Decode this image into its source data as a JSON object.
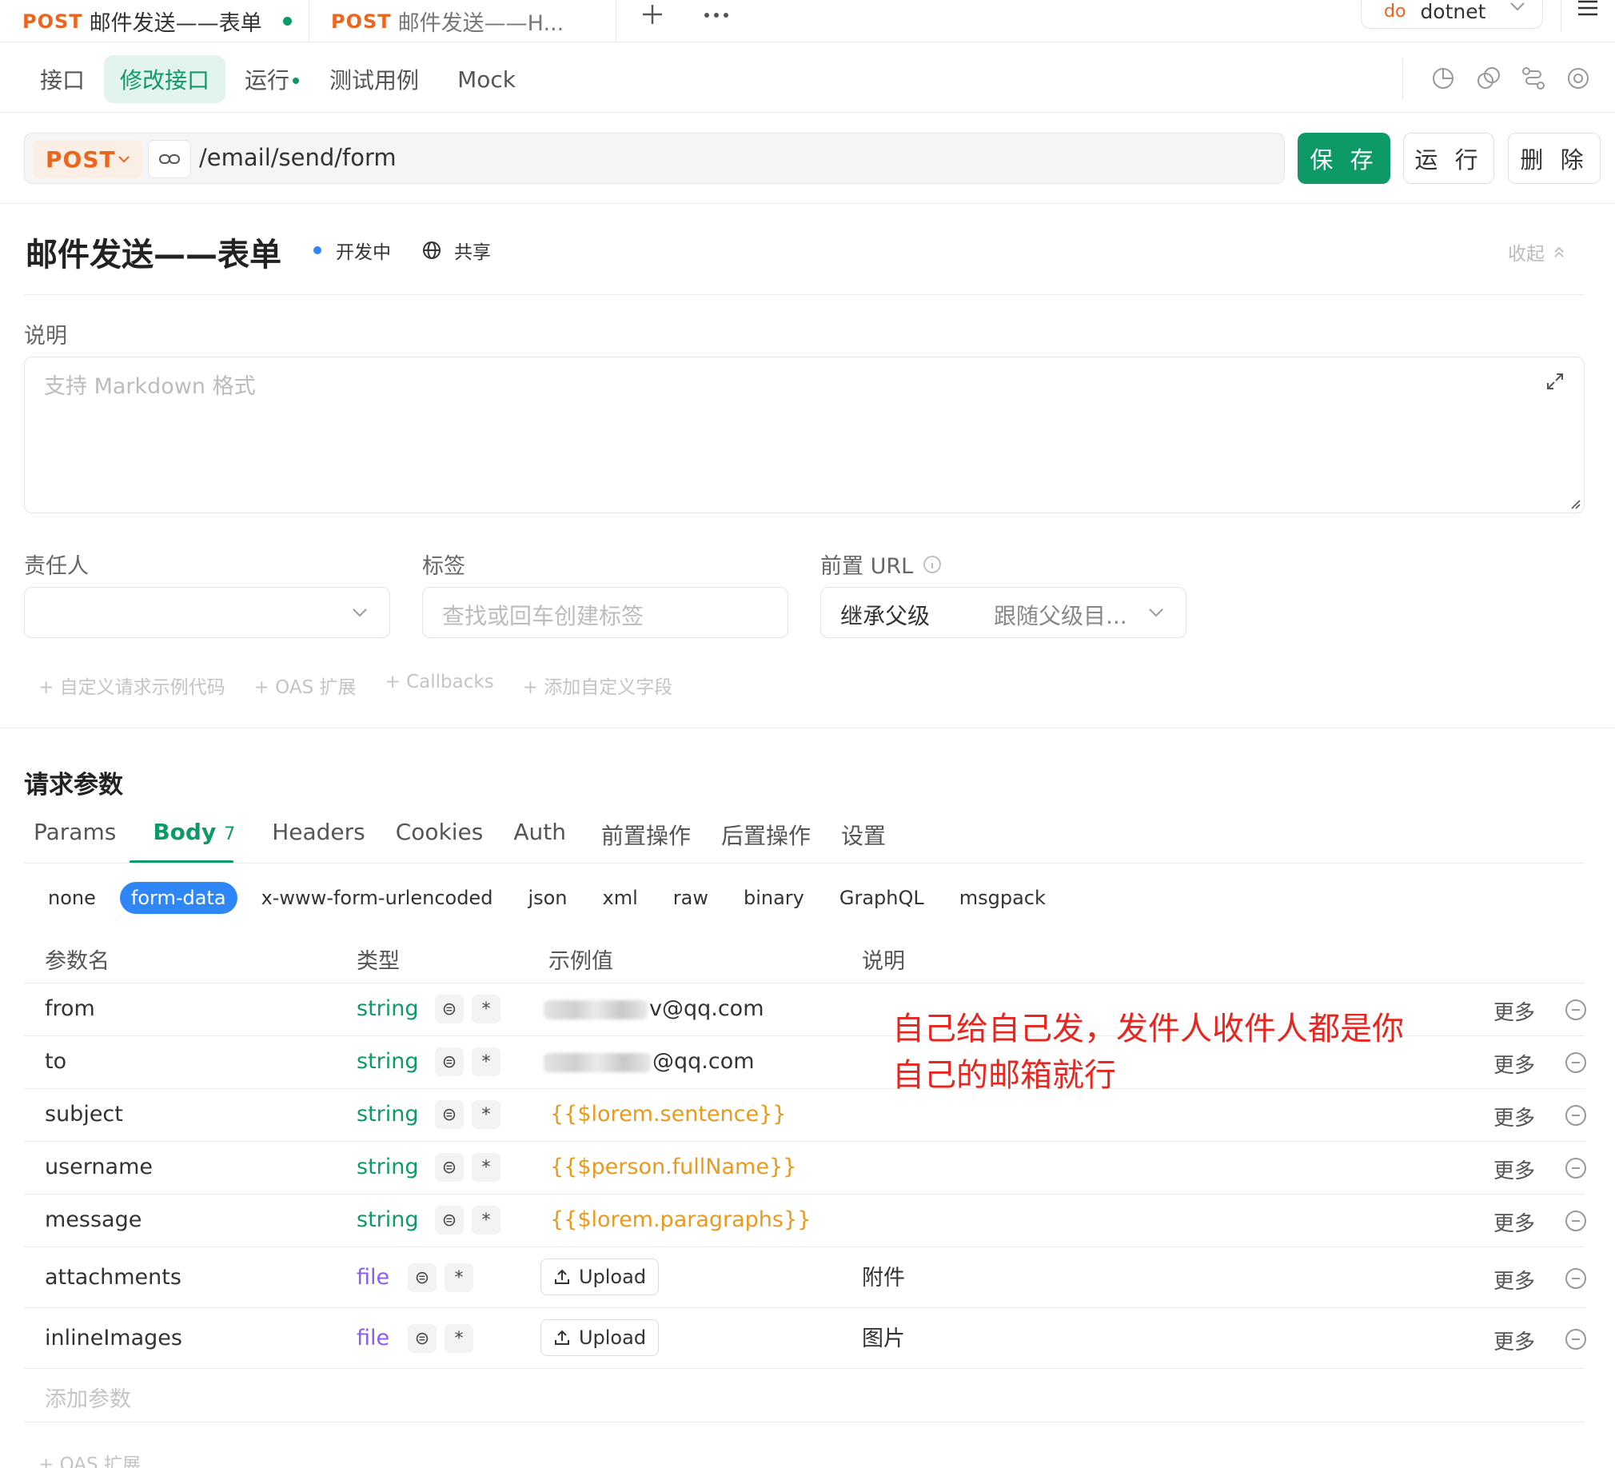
{
  "tabs": [
    {
      "method": "POST",
      "title": "邮件发送——表单",
      "modified": true
    },
    {
      "method": "POST",
      "title": "邮件发送——H..."
    }
  ],
  "env": {
    "badge": "do",
    "name": "dotnet"
  },
  "subtabs": [
    "接口",
    "修改接口",
    "运行",
    "测试用例",
    "Mock"
  ],
  "request": {
    "method": "POST",
    "path": "/email/send/form",
    "save_label": "保 存",
    "run_label": "运 行",
    "delete_label": "删 除"
  },
  "api": {
    "title": "邮件发送——表单",
    "status": "开发中",
    "share": "共享",
    "collapse": "收起"
  },
  "description": {
    "label": "说明",
    "placeholder": "支持 Markdown 格式"
  },
  "meta": {
    "owner_label": "责任人",
    "tags_label": "标签",
    "tags_placeholder": "查找或回车创建标签",
    "prefix_label": "前置 URL",
    "prefix_mode": "继承父级",
    "prefix_value": "跟随父级目..."
  },
  "add_links": [
    "+ 自定义请求示例代码",
    "+ OAS 扩展",
    "+ Callbacks",
    "+ 添加自定义字段"
  ],
  "params": {
    "section_title": "请求参数",
    "tabs": [
      {
        "label": "Params"
      },
      {
        "label": "Body",
        "count": "7"
      },
      {
        "label": "Headers"
      },
      {
        "label": "Cookies"
      },
      {
        "label": "Auth"
      },
      {
        "label": "前置操作"
      },
      {
        "label": "后置操作"
      },
      {
        "label": "设置"
      }
    ],
    "body_types": [
      "none",
      "form-data",
      "x-www-form-urlencoded",
      "json",
      "xml",
      "raw",
      "binary",
      "GraphQL",
      "msgpack"
    ],
    "columns": [
      "参数名",
      "类型",
      "示例值",
      "说明"
    ],
    "rows": [
      {
        "name": "from",
        "type": "string",
        "example": "v@qq.com",
        "desc": ""
      },
      {
        "name": "to",
        "type": "string",
        "example": "@qq.com",
        "desc": ""
      },
      {
        "name": "subject",
        "type": "string",
        "example": "{{$lorem.sentence}}",
        "desc": ""
      },
      {
        "name": "username",
        "type": "string",
        "example": "{{$person.fullName}}",
        "desc": ""
      },
      {
        "name": "message",
        "type": "string",
        "example": "{{$lorem.paragraphs}}",
        "desc": ""
      },
      {
        "name": "attachments",
        "type": "file",
        "example": "Upload",
        "desc": "附件"
      },
      {
        "name": "inlineImages",
        "type": "file",
        "example": "Upload",
        "desc": "图片"
      }
    ],
    "more_label": "更多",
    "add_param": "添加参数",
    "oas_ext": "+ OAS 扩展"
  },
  "annotation": {
    "line1": "自己给自己发，发件人收件人都是你",
    "line2": "自己的邮箱就行"
  },
  "colors": {
    "accent": "#0e9a67",
    "post": "#e8661f",
    "blue": "#2f86f6",
    "annotation": "#e8261f"
  }
}
